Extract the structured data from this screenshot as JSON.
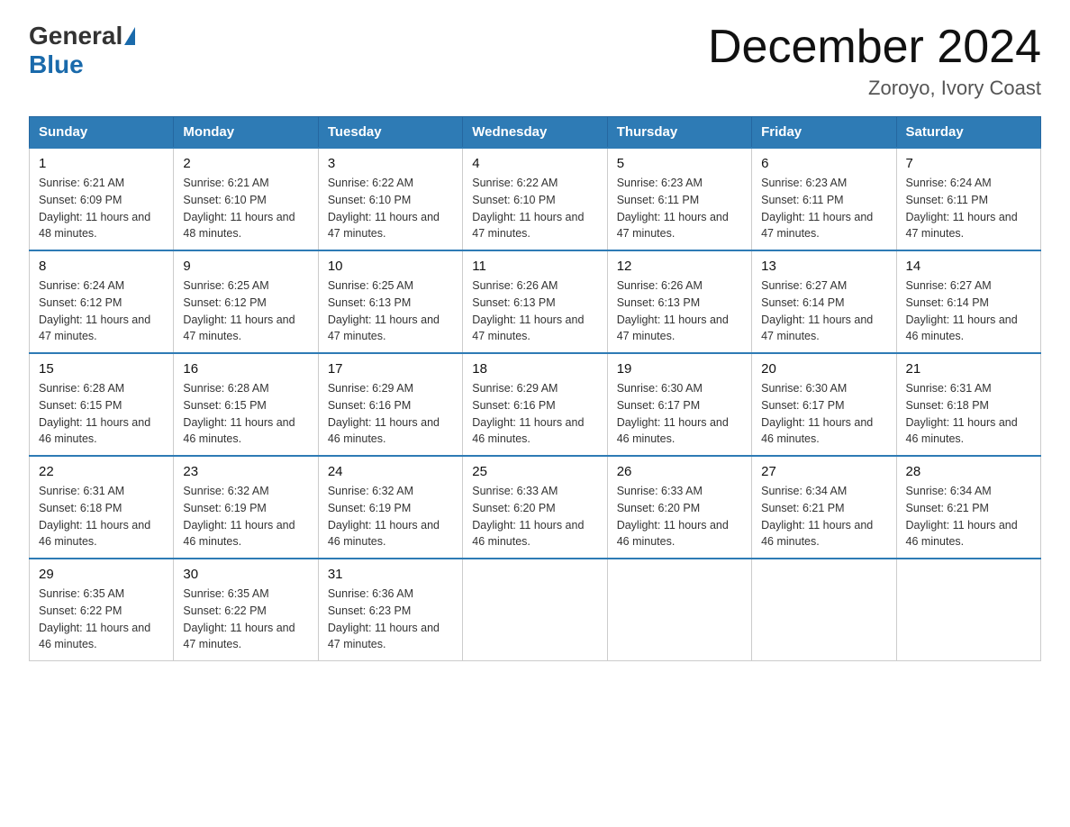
{
  "header": {
    "logo_general": "General",
    "logo_blue": "Blue",
    "title": "December 2024",
    "location": "Zoroyo, Ivory Coast"
  },
  "days_of_week": [
    "Sunday",
    "Monday",
    "Tuesday",
    "Wednesday",
    "Thursday",
    "Friday",
    "Saturday"
  ],
  "weeks": [
    [
      {
        "day": "1",
        "sunrise": "6:21 AM",
        "sunset": "6:09 PM",
        "daylight": "11 hours and 48 minutes."
      },
      {
        "day": "2",
        "sunrise": "6:21 AM",
        "sunset": "6:10 PM",
        "daylight": "11 hours and 48 minutes."
      },
      {
        "day": "3",
        "sunrise": "6:22 AM",
        "sunset": "6:10 PM",
        "daylight": "11 hours and 47 minutes."
      },
      {
        "day": "4",
        "sunrise": "6:22 AM",
        "sunset": "6:10 PM",
        "daylight": "11 hours and 47 minutes."
      },
      {
        "day": "5",
        "sunrise": "6:23 AM",
        "sunset": "6:11 PM",
        "daylight": "11 hours and 47 minutes."
      },
      {
        "day": "6",
        "sunrise": "6:23 AM",
        "sunset": "6:11 PM",
        "daylight": "11 hours and 47 minutes."
      },
      {
        "day": "7",
        "sunrise": "6:24 AM",
        "sunset": "6:11 PM",
        "daylight": "11 hours and 47 minutes."
      }
    ],
    [
      {
        "day": "8",
        "sunrise": "6:24 AM",
        "sunset": "6:12 PM",
        "daylight": "11 hours and 47 minutes."
      },
      {
        "day": "9",
        "sunrise": "6:25 AM",
        "sunset": "6:12 PM",
        "daylight": "11 hours and 47 minutes."
      },
      {
        "day": "10",
        "sunrise": "6:25 AM",
        "sunset": "6:13 PM",
        "daylight": "11 hours and 47 minutes."
      },
      {
        "day": "11",
        "sunrise": "6:26 AM",
        "sunset": "6:13 PM",
        "daylight": "11 hours and 47 minutes."
      },
      {
        "day": "12",
        "sunrise": "6:26 AM",
        "sunset": "6:13 PM",
        "daylight": "11 hours and 47 minutes."
      },
      {
        "day": "13",
        "sunrise": "6:27 AM",
        "sunset": "6:14 PM",
        "daylight": "11 hours and 47 minutes."
      },
      {
        "day": "14",
        "sunrise": "6:27 AM",
        "sunset": "6:14 PM",
        "daylight": "11 hours and 46 minutes."
      }
    ],
    [
      {
        "day": "15",
        "sunrise": "6:28 AM",
        "sunset": "6:15 PM",
        "daylight": "11 hours and 46 minutes."
      },
      {
        "day": "16",
        "sunrise": "6:28 AM",
        "sunset": "6:15 PM",
        "daylight": "11 hours and 46 minutes."
      },
      {
        "day": "17",
        "sunrise": "6:29 AM",
        "sunset": "6:16 PM",
        "daylight": "11 hours and 46 minutes."
      },
      {
        "day": "18",
        "sunrise": "6:29 AM",
        "sunset": "6:16 PM",
        "daylight": "11 hours and 46 minutes."
      },
      {
        "day": "19",
        "sunrise": "6:30 AM",
        "sunset": "6:17 PM",
        "daylight": "11 hours and 46 minutes."
      },
      {
        "day": "20",
        "sunrise": "6:30 AM",
        "sunset": "6:17 PM",
        "daylight": "11 hours and 46 minutes."
      },
      {
        "day": "21",
        "sunrise": "6:31 AM",
        "sunset": "6:18 PM",
        "daylight": "11 hours and 46 minutes."
      }
    ],
    [
      {
        "day": "22",
        "sunrise": "6:31 AM",
        "sunset": "6:18 PM",
        "daylight": "11 hours and 46 minutes."
      },
      {
        "day": "23",
        "sunrise": "6:32 AM",
        "sunset": "6:19 PM",
        "daylight": "11 hours and 46 minutes."
      },
      {
        "day": "24",
        "sunrise": "6:32 AM",
        "sunset": "6:19 PM",
        "daylight": "11 hours and 46 minutes."
      },
      {
        "day": "25",
        "sunrise": "6:33 AM",
        "sunset": "6:20 PM",
        "daylight": "11 hours and 46 minutes."
      },
      {
        "day": "26",
        "sunrise": "6:33 AM",
        "sunset": "6:20 PM",
        "daylight": "11 hours and 46 minutes."
      },
      {
        "day": "27",
        "sunrise": "6:34 AM",
        "sunset": "6:21 PM",
        "daylight": "11 hours and 46 minutes."
      },
      {
        "day": "28",
        "sunrise": "6:34 AM",
        "sunset": "6:21 PM",
        "daylight": "11 hours and 46 minutes."
      }
    ],
    [
      {
        "day": "29",
        "sunrise": "6:35 AM",
        "sunset": "6:22 PM",
        "daylight": "11 hours and 46 minutes."
      },
      {
        "day": "30",
        "sunrise": "6:35 AM",
        "sunset": "6:22 PM",
        "daylight": "11 hours and 47 minutes."
      },
      {
        "day": "31",
        "sunrise": "6:36 AM",
        "sunset": "6:23 PM",
        "daylight": "11 hours and 47 minutes."
      },
      null,
      null,
      null,
      null
    ]
  ]
}
